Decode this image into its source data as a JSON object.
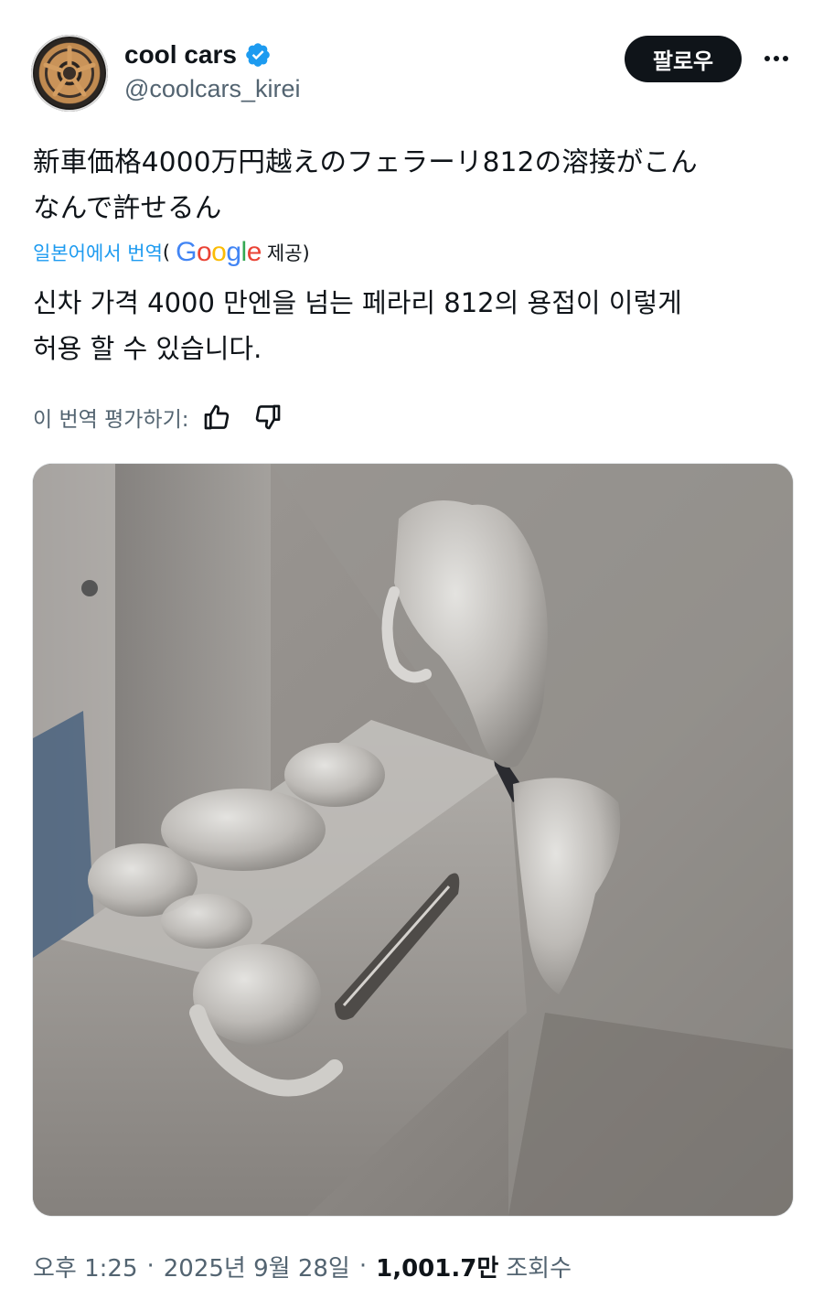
{
  "author": {
    "name": "cool cars",
    "handle": "@coolcars_kirei",
    "verified": true,
    "follow_label": "팔로우",
    "avatar_icon": "wheel-avatar"
  },
  "post": {
    "original_line1": "新車価格4000万円越えのフェラーリ812の溶接がこん",
    "original_line2": "なんで許せるん",
    "translated_from": "일본어에서 번역",
    "paren_open": "(",
    "google_letters": [
      "G",
      "o",
      "o",
      "g",
      "l",
      "e"
    ],
    "provided": "제공)",
    "translation_line1": "신차 가격 4000 만엔을 넘는 페라리 812의 용접이 이렇게",
    "translation_line2": "허용 할 수 있습니다.",
    "rate_label": "이 번역 평가하기:",
    "image_icon": "welded-metal-bracket-photo"
  },
  "meta": {
    "time": "오후 1:25",
    "date": "2025년 9월 28일",
    "separator": "·",
    "views_count": "1,001.7만",
    "views_label": "조회수"
  },
  "colors": {
    "text": "#0f1419",
    "secondary": "#536471",
    "link": "#1d9bf0",
    "verified": "#1d9bf0",
    "button_bg": "#0f1419"
  }
}
